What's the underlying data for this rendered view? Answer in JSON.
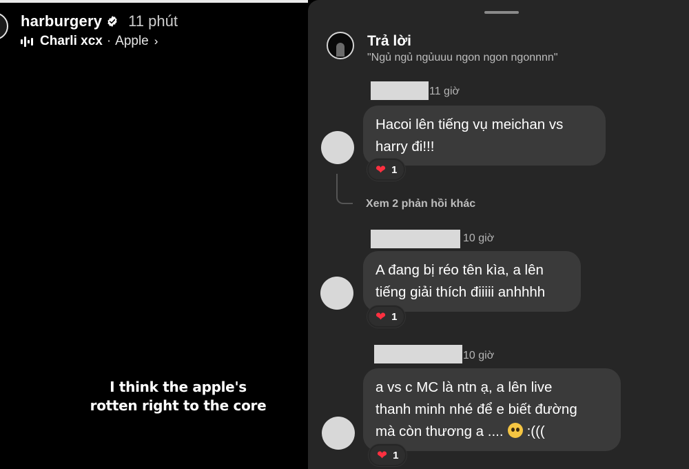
{
  "story": {
    "username": "harburgery",
    "time_ago": "11 phút",
    "music": {
      "artist": "Charli xcx",
      "separator": "·",
      "track": "Apple",
      "chevron": "›"
    },
    "caption_line1": "I think the apple's",
    "caption_line2": "rotten right to the core",
    "icons": {
      "verified": "verified-badge-icon",
      "music": "equalizer-icon"
    },
    "progress": 1.0
  },
  "sheet": {
    "title": "Trả lời",
    "quote": "\"Ngủ ngủ ngủuuu ngon ngon ngonnnn\"",
    "more_replies": "Xem 2 phản hồi khác"
  },
  "comments": [
    {
      "time": "11 giờ",
      "text_line1": "Hacoi lên tiếng vụ meichan vs",
      "text_line2": "harry đi!!!",
      "reaction_emoji": "❤",
      "reaction_count": "1"
    },
    {
      "time": "10 giờ",
      "text_line1": "A đang bị réo tên kìa, a lên",
      "text_line2": "tiếng giải thích điiiii anhhhh",
      "reaction_emoji": "❤",
      "reaction_count": "1"
    },
    {
      "time": "10 giờ",
      "text_line1": "a vs c MC là ntn ạ, a lên live",
      "text_line2": "thanh minh nhé để e biết đường",
      "text_line3_a": "mà còn thương a ....",
      "text_line3_b": ":(((",
      "reaction_emoji": "❤",
      "reaction_count": "1"
    }
  ],
  "colors": {
    "story_bg": "#000000",
    "sheet_bg": "#262626",
    "bubble_bg": "#3a3a3a",
    "heart": "#ff3040",
    "redaction": "#d9d9d9"
  }
}
